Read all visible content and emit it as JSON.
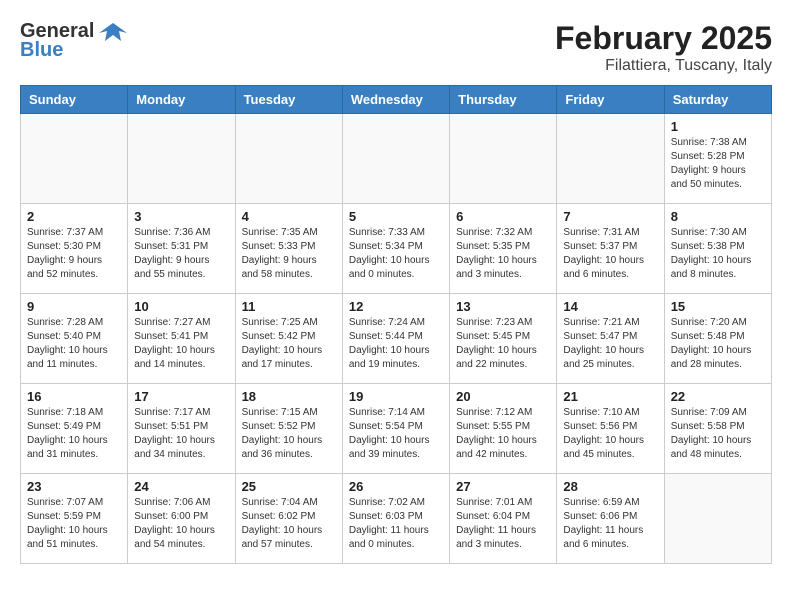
{
  "header": {
    "logo_general": "General",
    "logo_blue": "Blue",
    "month_title": "February 2025",
    "location": "Filattiera, Tuscany, Italy"
  },
  "weekdays": [
    "Sunday",
    "Monday",
    "Tuesday",
    "Wednesday",
    "Thursday",
    "Friday",
    "Saturday"
  ],
  "weeks": [
    [
      {
        "day": "",
        "info": ""
      },
      {
        "day": "",
        "info": ""
      },
      {
        "day": "",
        "info": ""
      },
      {
        "day": "",
        "info": ""
      },
      {
        "day": "",
        "info": ""
      },
      {
        "day": "",
        "info": ""
      },
      {
        "day": "1",
        "info": "Sunrise: 7:38 AM\nSunset: 5:28 PM\nDaylight: 9 hours and 50 minutes."
      }
    ],
    [
      {
        "day": "2",
        "info": "Sunrise: 7:37 AM\nSunset: 5:30 PM\nDaylight: 9 hours and 52 minutes."
      },
      {
        "day": "3",
        "info": "Sunrise: 7:36 AM\nSunset: 5:31 PM\nDaylight: 9 hours and 55 minutes."
      },
      {
        "day": "4",
        "info": "Sunrise: 7:35 AM\nSunset: 5:33 PM\nDaylight: 9 hours and 58 minutes."
      },
      {
        "day": "5",
        "info": "Sunrise: 7:33 AM\nSunset: 5:34 PM\nDaylight: 10 hours and 0 minutes."
      },
      {
        "day": "6",
        "info": "Sunrise: 7:32 AM\nSunset: 5:35 PM\nDaylight: 10 hours and 3 minutes."
      },
      {
        "day": "7",
        "info": "Sunrise: 7:31 AM\nSunset: 5:37 PM\nDaylight: 10 hours and 6 minutes."
      },
      {
        "day": "8",
        "info": "Sunrise: 7:30 AM\nSunset: 5:38 PM\nDaylight: 10 hours and 8 minutes."
      }
    ],
    [
      {
        "day": "9",
        "info": "Sunrise: 7:28 AM\nSunset: 5:40 PM\nDaylight: 10 hours and 11 minutes."
      },
      {
        "day": "10",
        "info": "Sunrise: 7:27 AM\nSunset: 5:41 PM\nDaylight: 10 hours and 14 minutes."
      },
      {
        "day": "11",
        "info": "Sunrise: 7:25 AM\nSunset: 5:42 PM\nDaylight: 10 hours and 17 minutes."
      },
      {
        "day": "12",
        "info": "Sunrise: 7:24 AM\nSunset: 5:44 PM\nDaylight: 10 hours and 19 minutes."
      },
      {
        "day": "13",
        "info": "Sunrise: 7:23 AM\nSunset: 5:45 PM\nDaylight: 10 hours and 22 minutes."
      },
      {
        "day": "14",
        "info": "Sunrise: 7:21 AM\nSunset: 5:47 PM\nDaylight: 10 hours and 25 minutes."
      },
      {
        "day": "15",
        "info": "Sunrise: 7:20 AM\nSunset: 5:48 PM\nDaylight: 10 hours and 28 minutes."
      }
    ],
    [
      {
        "day": "16",
        "info": "Sunrise: 7:18 AM\nSunset: 5:49 PM\nDaylight: 10 hours and 31 minutes."
      },
      {
        "day": "17",
        "info": "Sunrise: 7:17 AM\nSunset: 5:51 PM\nDaylight: 10 hours and 34 minutes."
      },
      {
        "day": "18",
        "info": "Sunrise: 7:15 AM\nSunset: 5:52 PM\nDaylight: 10 hours and 36 minutes."
      },
      {
        "day": "19",
        "info": "Sunrise: 7:14 AM\nSunset: 5:54 PM\nDaylight: 10 hours and 39 minutes."
      },
      {
        "day": "20",
        "info": "Sunrise: 7:12 AM\nSunset: 5:55 PM\nDaylight: 10 hours and 42 minutes."
      },
      {
        "day": "21",
        "info": "Sunrise: 7:10 AM\nSunset: 5:56 PM\nDaylight: 10 hours and 45 minutes."
      },
      {
        "day": "22",
        "info": "Sunrise: 7:09 AM\nSunset: 5:58 PM\nDaylight: 10 hours and 48 minutes."
      }
    ],
    [
      {
        "day": "23",
        "info": "Sunrise: 7:07 AM\nSunset: 5:59 PM\nDaylight: 10 hours and 51 minutes."
      },
      {
        "day": "24",
        "info": "Sunrise: 7:06 AM\nSunset: 6:00 PM\nDaylight: 10 hours and 54 minutes."
      },
      {
        "day": "25",
        "info": "Sunrise: 7:04 AM\nSunset: 6:02 PM\nDaylight: 10 hours and 57 minutes."
      },
      {
        "day": "26",
        "info": "Sunrise: 7:02 AM\nSunset: 6:03 PM\nDaylight: 11 hours and 0 minutes."
      },
      {
        "day": "27",
        "info": "Sunrise: 7:01 AM\nSunset: 6:04 PM\nDaylight: 11 hours and 3 minutes."
      },
      {
        "day": "28",
        "info": "Sunrise: 6:59 AM\nSunset: 6:06 PM\nDaylight: 11 hours and 6 minutes."
      },
      {
        "day": "",
        "info": ""
      }
    ]
  ]
}
